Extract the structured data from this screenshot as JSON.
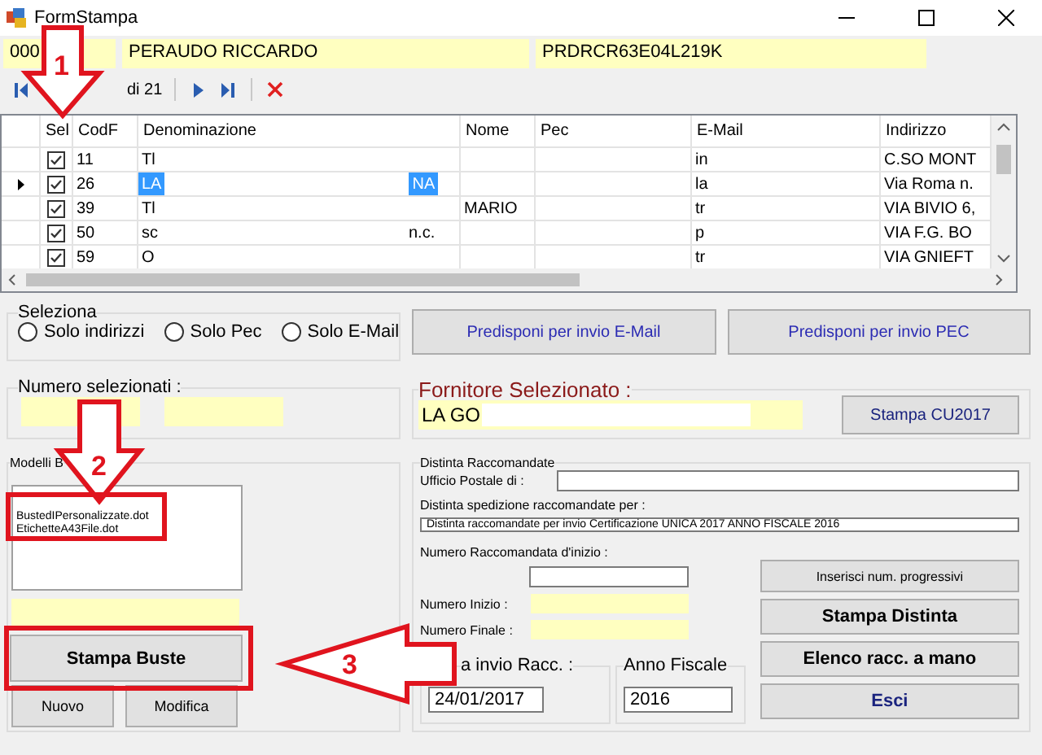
{
  "window": {
    "title": "FormStampa"
  },
  "header_fields": [
    "000",
    "PERAUDO RICCARDO",
    "PRDRCR63E04L219K"
  ],
  "navigator": {
    "count": "di 21"
  },
  "table": {
    "columns": [
      "Sel",
      "CodF",
      "Denominazione",
      "Nome",
      "Pec",
      "E-Mail",
      "Indirizzo"
    ],
    "rows": [
      {
        "current": false,
        "checked": true,
        "codf": "11",
        "denominazione": "Tl",
        "denominazione_end": "",
        "nome": "",
        "pec": "",
        "email": "in",
        "indirizzo": "C.SO MONT",
        "selected": false
      },
      {
        "current": true,
        "checked": true,
        "codf": "26",
        "denominazione": "LA",
        "denominazione_end": "NA",
        "nome": "",
        "pec": "",
        "email": "la",
        "indirizzo": "Via Roma n.",
        "selected": true
      },
      {
        "current": false,
        "checked": true,
        "codf": "39",
        "denominazione": "Tl",
        "denominazione_end": "",
        "nome": "MARIO",
        "pec": "",
        "email": "tr",
        "indirizzo": "VIA BIVIO 6,",
        "selected": false
      },
      {
        "current": false,
        "checked": true,
        "codf": "50",
        "denominazione": "sc",
        "denominazione_end": "n.c.",
        "nome": "",
        "pec": "",
        "email": "p",
        "indirizzo": "VIA F.G. BO",
        "selected": false
      },
      {
        "current": false,
        "checked": true,
        "codf": "59",
        "denominazione": "O",
        "denominazione_end": "",
        "nome": "",
        "pec": "",
        "email": "tr",
        "indirizzo": "VIA GNIEFT",
        "selected": false
      }
    ]
  },
  "selection": {
    "label": "Seleziona",
    "options": [
      {
        "label": "Solo indirizzi",
        "selected": false
      },
      {
        "label": "Solo Pec",
        "selected": false
      },
      {
        "label": "Solo E-Mail",
        "selected": false
      }
    ]
  },
  "send_buttons": [
    "Predisponi per invio E-Mail",
    "Predisponi per invio PEC"
  ],
  "selected_count": {
    "label": "Numero  selezionati :"
  },
  "supplier": {
    "label": "Fornitore Selezionato :",
    "value": "LA GO",
    "button": "Stampa CU2017"
  },
  "templates": {
    "label": "Modelli B",
    "items": [
      "BustedIPersonalizzate.dot",
      "EtichetteA43File.dot"
    ],
    "print_button": "Stampa Buste",
    "new_button": "Nuovo",
    "edit_button": "Modifica"
  },
  "registered_mail": {
    "label": "Distinta Raccomandate",
    "post_office_label": "Ufficio Postale di :",
    "list_for_label": "Distinta spedizione raccomandate per :",
    "list_for_value": "Distinta raccomandate per invio Certificazione UNICA 2017 ANNO FISCALE 2016",
    "start_number_label": "Numero Raccomandata d'inizio :",
    "first_number_label": "Numero Inizio :",
    "last_number_label": "Numero Finale :",
    "date_label": "a  invio Racc. :",
    "date_value": "24/01/2017",
    "year_label": "Anno Fiscale",
    "year_value": "2016",
    "buttons": [
      {
        "label": "Inserisci num. progressivi",
        "kind": "plain"
      },
      {
        "label": "Stampa Distinta",
        "kind": "bold"
      },
      {
        "label": "Elenco racc. a mano",
        "kind": "bold"
      },
      {
        "label": "Esci",
        "kind": "exit"
      }
    ]
  },
  "annotations": [
    "1",
    "2",
    "3"
  ]
}
